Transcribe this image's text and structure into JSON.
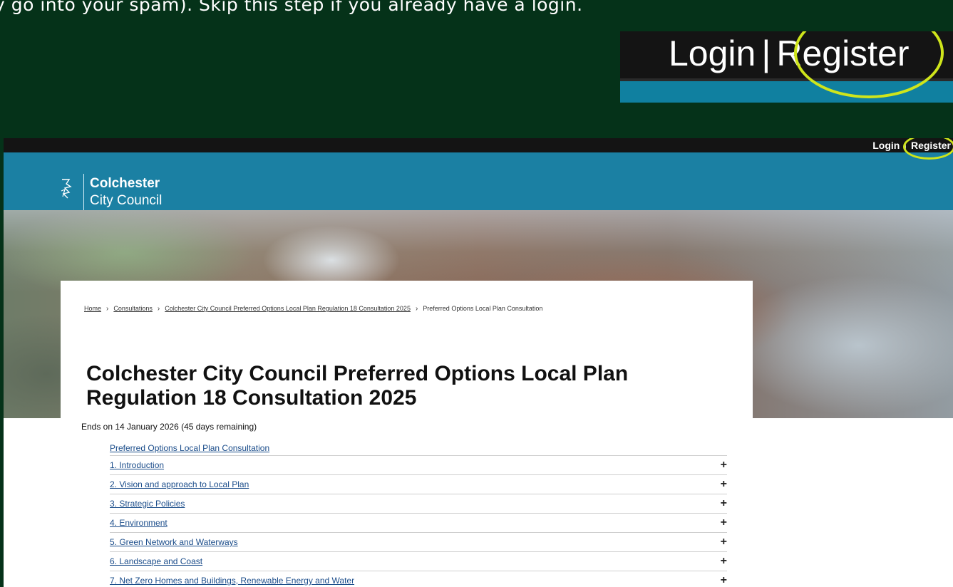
{
  "instruction": {
    "text": "y go into your spam). Skip this step if you already have a login."
  },
  "zoom_callout": {
    "login": "Login",
    "pipe": "|",
    "register": "Register"
  },
  "site": {
    "topbar": {
      "login": "Login",
      "pipe": "|",
      "register": "Register"
    },
    "brand": {
      "name_line1": "Colchester",
      "name_line2": "City Council",
      "logo_icon": "colchester-logo-icon"
    },
    "breadcrumb": [
      {
        "label": "Home"
      },
      {
        "label": "Consultations"
      },
      {
        "label": "Colchester City Council Preferred Options Local Plan Regulation 18 Consultation 2025"
      },
      {
        "label": "Preferred Options Local Plan Consultation"
      }
    ],
    "breadcrumb_sep": "›",
    "title": "Colchester City Council Preferred Options Local Plan Regulation 18 Consultation 2025",
    "ends": "Ends on 14 January 2026 (45 days remaining)",
    "toc": {
      "first": "Preferred Options Local Plan Consultation",
      "items": [
        {
          "label": "1. Introduction",
          "expand": "+"
        },
        {
          "label": "2. Vision and approach to Local Plan",
          "expand": "+"
        },
        {
          "label": "3. Strategic Policies",
          "expand": "+"
        },
        {
          "label": "4. Environment",
          "expand": "+"
        },
        {
          "label": "5. Green Network and Waterways",
          "expand": "+"
        },
        {
          "label": "6. Landscape and Coast",
          "expand": "+"
        },
        {
          "label": "7. Net Zero Homes and Buildings, Renewable Energy and Water",
          "expand": "+"
        }
      ]
    }
  },
  "colors": {
    "background": "#053219",
    "highlight_ring": "#cfe51b",
    "header_teal": "#1b80a3",
    "topbar": "#141414",
    "link": "#1a4c8a"
  }
}
